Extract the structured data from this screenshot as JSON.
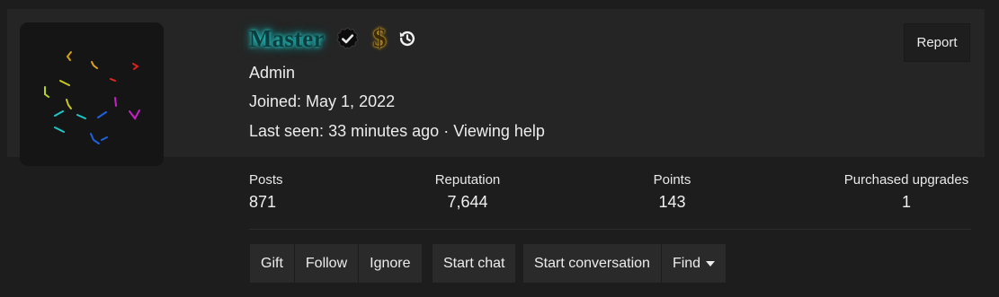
{
  "profile": {
    "username": "Master",
    "role": "Admin",
    "joined": "Joined: May 1, 2022",
    "last_seen_prefix": "Last seen:",
    "last_seen_time": "33 minutes ago",
    "separator": "·",
    "activity": "Viewing help",
    "dollar_glyph": "$"
  },
  "actions": {
    "report_label": "Report"
  },
  "stats": {
    "posts": {
      "label": "Posts",
      "value": "871"
    },
    "reputation": {
      "label": "Reputation",
      "value": "7,644"
    },
    "points": {
      "label": "Points",
      "value": "143"
    },
    "upgrades": {
      "label": "Purchased upgrades",
      "value": "1"
    }
  },
  "buttons": {
    "gift": "Gift",
    "follow": "Follow",
    "ignore": "Ignore",
    "start_chat": "Start chat",
    "start_conversation": "Start conversation",
    "find": "Find"
  },
  "icons": {
    "verified": "verified-badge-icon",
    "dollar": "dollar-icon",
    "history": "history-icon",
    "dropdown": "caret-down-icon"
  },
  "colors": {
    "background": "#1d1d1d",
    "banner": "#252525",
    "username_glow": "#2fd0d0",
    "dollar_gold": "#d9a520"
  }
}
